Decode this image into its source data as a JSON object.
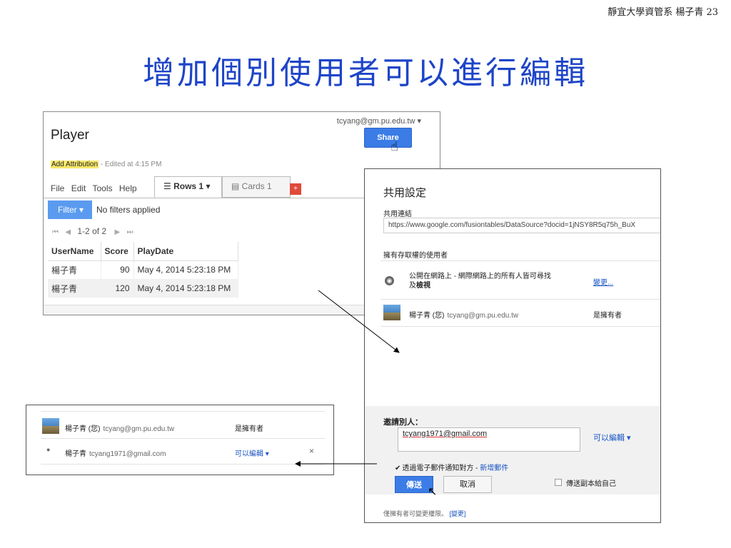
{
  "slide": {
    "header": "靜宜大學資管系 楊子青 23",
    "title": "增加個別使用者可以進行編輯"
  },
  "fusion_table": {
    "user_email": "tcyang@gm.pu.edu.tw ▾",
    "title": "Player",
    "share_label": "Share",
    "attribution_label": "Add Attribution",
    "edited_text": "- Edited at 4:15 PM",
    "menu": [
      "File",
      "Edit",
      "Tools",
      "Help"
    ],
    "tab_rows": "☰ Rows 1 ▾",
    "tab_cards": "▤ Cards 1",
    "tab_add": "+",
    "filter_label": "Filter ▾",
    "filter_status": "No filters applied",
    "pager": "1-2 of 2",
    "columns": [
      "UserName",
      "Score",
      "PlayDate"
    ],
    "rows": [
      [
        "楊子青",
        "90",
        "May 4, 2014 5:23:18 PM"
      ],
      [
        "楊子青",
        "120",
        "May 4, 2014 5:23:18 PM"
      ]
    ]
  },
  "share_dialog": {
    "title": "共用設定",
    "link_label": "共用連結",
    "link_value": "https://www.google.com/fusiontables/DataSource?docid=1jNSY8R5q75h_BuX",
    "access_label": "擁有存取權的使用者",
    "public_text_line1": "公開在網路上 - 網際網路上的所有人皆可尋找",
    "public_text_line2_prefix": "及",
    "public_text_line2_bold": "檢視",
    "change_link": "變更...",
    "owner_name": "楊子青 (您)",
    "owner_email": "tcyang@gm.pu.edu.tw",
    "owner_role": "是擁有者",
    "invite_label": "邀請別人：",
    "invite_value": "tcyang1971@gmail.com",
    "permission": "可以編輯 ▾",
    "notify_text": "透過電子郵件通知對方 - ",
    "new_mail_link": "新增郵件",
    "send_label": "傳送",
    "cancel_label": "取消",
    "copy_label": "傳送副本給自己",
    "footer_text": "僅擁有者可變更權限。",
    "footer_link": "[變更]"
  },
  "user_list": {
    "owner_name": "楊子青 (您)",
    "owner_email": "tcyang@gm.pu.edu.tw",
    "owner_role": "是擁有者",
    "editor_name": "楊子青",
    "editor_email": "tcyang1971@gmail.com",
    "editor_permission": "可以編輯 ▾",
    "remove": "×"
  },
  "colors": {
    "title_blue": "#1e45c8",
    "button_blue": "#3b7ce6",
    "link_blue": "#1a55c4",
    "attribution_yellow": "#f6e76a",
    "add_tab_red": "#e04a3a"
  }
}
